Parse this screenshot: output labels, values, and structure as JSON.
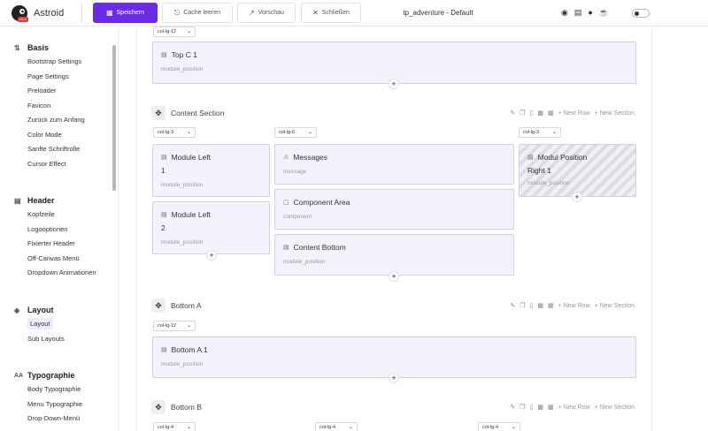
{
  "app": {
    "brand": "Astroid",
    "version": "v3.1",
    "title": "tp_adventure - Default"
  },
  "toolbar": {
    "save": "Speichern",
    "clear_cache": "Cache leeren",
    "preview": "Vorschau",
    "close": "Schließen"
  },
  "sidebar": {
    "groups": [
      {
        "title": "Basis",
        "icon": "sliders-icon",
        "items": [
          "Bootstrap Settings",
          "Page Settings",
          "Preloader",
          "Favicon",
          "Zurück zum Anfang",
          "Color Mode",
          "Sanfte Schriftrolle",
          "Cursor Effect"
        ]
      },
      {
        "title": "Header",
        "icon": "header-icon",
        "items": [
          "Kopfzeile",
          "Logooptionen",
          "Fixierter Header",
          "Off-Canvas Menü",
          "Dropdown Animationen"
        ]
      },
      {
        "title": "Layout",
        "icon": "layers-icon",
        "items": [
          "Layout",
          "Sub Layouts"
        ]
      },
      {
        "title": "Typographie",
        "icon": "typography-icon",
        "items": [
          "Body Typographie",
          "Menu Typographie",
          "Drop-Down-Menü"
        ]
      }
    ]
  },
  "sections": {
    "top_c": {
      "col": "col-lg-12",
      "module": {
        "title": "Top C 1",
        "sub": "module_position"
      }
    },
    "content": {
      "title": "Content Section",
      "new_row": "New Row",
      "new_section": "New Section",
      "cols": [
        "col-lg-3",
        "col-lg-6",
        "col-lg-3"
      ],
      "left": [
        {
          "title": "Module Left",
          "title2": "1",
          "sub": "module_position"
        },
        {
          "title": "Module Left",
          "title2": "2",
          "sub": "module_position"
        }
      ],
      "middle": [
        {
          "title": "Messages",
          "sub": "message"
        },
        {
          "title": "Component Area",
          "sub": "component"
        },
        {
          "title": "Content Bottom",
          "sub": "module_position"
        }
      ],
      "right": {
        "title": "Modul Position",
        "title2": "Right 1",
        "sub": "module_position"
      }
    },
    "bottom_a": {
      "title": "Bottom A",
      "new_row": "New Row",
      "new_section": "New Section",
      "col": "col-lg-12",
      "module": {
        "title": "Bottom A 1",
        "sub": "module_position"
      }
    },
    "bottom_b": {
      "title": "Bottom B",
      "new_row": "New Row",
      "new_section": "New Section",
      "cols": [
        "col-lg-4",
        "col-lg-4",
        "col-lg-4"
      ]
    }
  },
  "plus": "+"
}
